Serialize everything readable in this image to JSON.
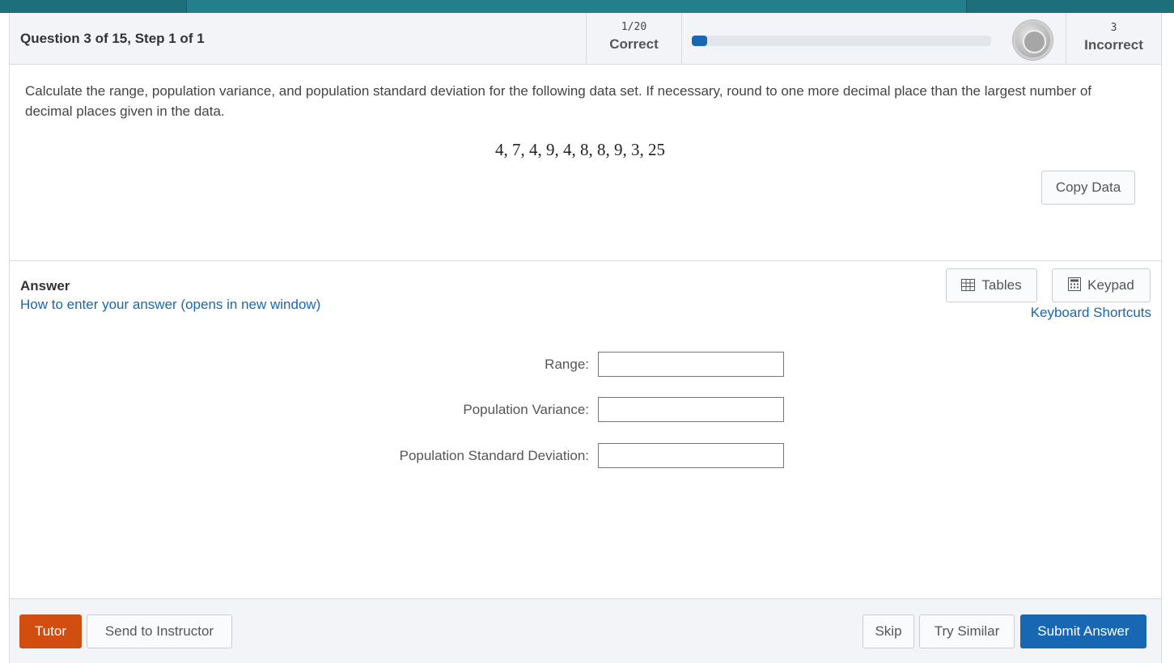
{
  "header": {
    "question_label": "Question 3 of 15,  Step 1 of 1",
    "correct_count": "1/20",
    "correct_label": "Correct",
    "progress_fraction": 0.05,
    "incorrect_count": "3",
    "incorrect_label": "Incorrect",
    "medal_icon": "medal-icon"
  },
  "question": {
    "prompt": "Calculate the range, population variance, and population standard deviation for the following data set. If necessary, round to one more decimal place than the largest number of decimal places given in the data.",
    "dataset": "4, 7, 4, 9, 4, 8, 8, 9, 3, 25",
    "copy_label": "Copy Data"
  },
  "answer": {
    "title": "Answer",
    "how_link": "How to enter your answer (opens in new window)",
    "tables_label": "Tables",
    "keypad_label": "Keypad",
    "shortcuts_link": "Keyboard Shortcuts",
    "fields": [
      {
        "label": "Range:",
        "value": ""
      },
      {
        "label": "Population Variance:",
        "value": ""
      },
      {
        "label": "Population Standard Deviation:",
        "value": ""
      }
    ]
  },
  "footer": {
    "tutor_label": "Tutor",
    "send_label": "Send to Instructor",
    "skip_label": "Skip",
    "similar_label": "Try Similar",
    "submit_label": "Submit Answer"
  },
  "colors": {
    "topbar": "#237f8c",
    "accent_blue": "#1767b3",
    "tutor_orange": "#d24e10"
  }
}
